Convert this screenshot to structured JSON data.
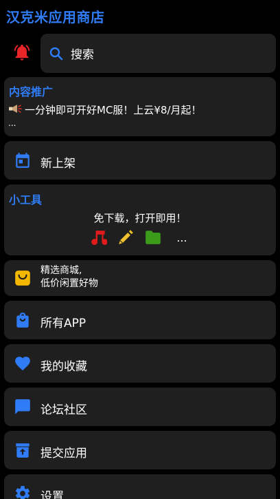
{
  "app": {
    "title": "汉克米应用商店"
  },
  "search": {
    "label": "搜索"
  },
  "promo": {
    "title": "内容推广",
    "text": "一分钟即可开好MC服！上云¥8/月起！",
    "more": "..."
  },
  "menu": {
    "new_arrivals": "新上架",
    "all_apps": "所有APP",
    "favorites": "我的收藏",
    "forum": "论坛社区",
    "submit_app": "提交应用",
    "settings": "设置"
  },
  "tools": {
    "title": "小工具",
    "subtitle": "免下载，打开即用！",
    "more": "...",
    "icons": [
      "music-note-icon",
      "pen-icon",
      "folder-icon"
    ]
  },
  "mall": {
    "line1": "精选商城,",
    "line2": "低价闲置好物"
  },
  "colors": {
    "accent": "#2f7cf6",
    "card_bg": "#1f1f1f",
    "background": "#000000",
    "bell": "#e8262a",
    "music": "#e01b1b",
    "pen": "#f2c12e",
    "folder": "#3a9a1a",
    "mall": "#f5b800"
  }
}
